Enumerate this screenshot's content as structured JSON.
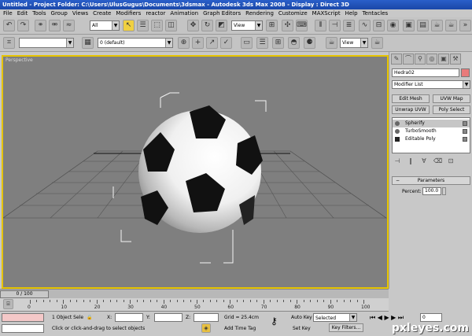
{
  "window": {
    "title": "Untitled    - Project Folder: C:\\Users\\UlusGugus\\Documents\\3dsmax        - Autodesk 3ds Max 2008        - Display : Direct 3D"
  },
  "menu": [
    "File",
    "Edit",
    "Tools",
    "Group",
    "Views",
    "Create",
    "Modifiers",
    "reactor",
    "Animation",
    "Graph Editors",
    "Rendering",
    "Customize",
    "MAXScript",
    "Help",
    "Tentacles"
  ],
  "toolbar": {
    "selection_filter": "All",
    "ref_coord": "View",
    "named_selection": "",
    "layer": "0 (default)",
    "view_dropdown": "View"
  },
  "viewport": {
    "label": "Perspective"
  },
  "command_panel": {
    "object_name": "Hedra02",
    "object_color": "#e87a7a",
    "modifier_list": "Modifier List",
    "buttons": [
      "Edit Mesh",
      "UVW Map",
      "Unwrap UVW",
      "Poly Select"
    ],
    "stack": [
      "Spherify",
      "TurboSmooth",
      "Editable Poly"
    ],
    "rollout_title": "Parameters",
    "percent_label": "Percent:",
    "percent_value": "100.0"
  },
  "timeline": {
    "slider_label": "0 / 100",
    "ticks": [
      "0",
      "10",
      "20",
      "30",
      "40",
      "50",
      "60",
      "70",
      "80",
      "90",
      "100"
    ]
  },
  "status": {
    "selection": "1 Object Sele",
    "prompt": "Click or click-and-drag to select objects",
    "x_label": "X:",
    "y_label": "Y:",
    "z_label": "Z:",
    "grid": "Grid = 25.4cm",
    "add_time_tag": "Add Time Tag",
    "auto_key": "Auto Key",
    "auto_key_mode": "Selected",
    "set_key": "Set Key",
    "key_filters": "Key Filters...",
    "frame": "0"
  },
  "watermark": "pxleyes.com"
}
